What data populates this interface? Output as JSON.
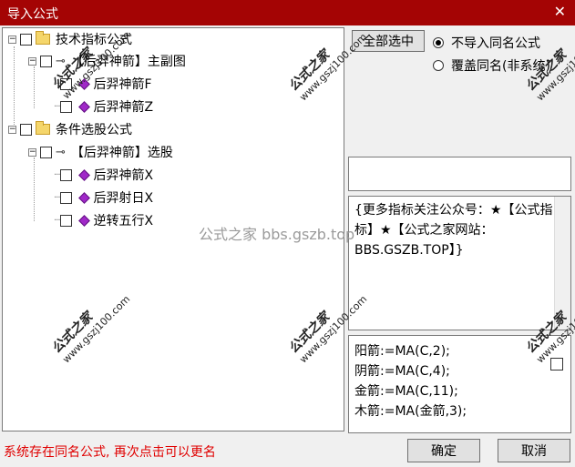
{
  "window": {
    "title": "导入公式",
    "close_glyph": "✕"
  },
  "tree": {
    "groups": [
      {
        "label": "技术指标公式",
        "children": [
          {
            "label": "【后羿神箭】主副图",
            "children": [
              "后羿神箭F",
              "后羿神箭Z"
            ]
          }
        ]
      },
      {
        "label": "条件选股公式",
        "children": [
          {
            "label": "【后羿神箭】选股",
            "children": [
              "后羿神箭X",
              "后羿射日X",
              "逆转五行X"
            ]
          }
        ]
      }
    ]
  },
  "controls": {
    "select_all": "全部选中",
    "radio_no_import": "不导入同名公式",
    "radio_overwrite": "覆盖同名(非系统)",
    "selected_radio": "no_import"
  },
  "description": "{更多指标关注公众号：★【公式指标】★【公式之家网站：BBS.GSZB.TOP】}",
  "formula_lines": [
    "阳箭:=MA(C,2);",
    "阴箭:=MA(C,4);",
    "金箭:=MA(C,11);",
    "木箭:=MA(金箭,3);"
  ],
  "status_message": "系统存在同名公式, 再次点击可以更名",
  "buttons": {
    "ok": "确定",
    "cancel": "取消"
  },
  "watermark": {
    "center_text": "公式之家 bbs.gszb.top",
    "stamp_title": "公式之家",
    "stamp_url": "www.gszj100.com"
  }
}
